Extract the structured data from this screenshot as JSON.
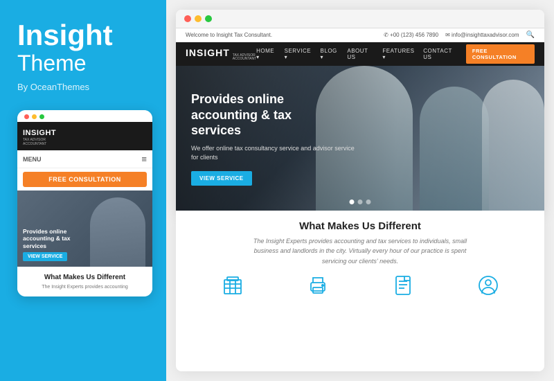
{
  "left": {
    "title_insight": "Insight",
    "title_theme": "Theme",
    "by_label": "By OceanThemes"
  },
  "mobile": {
    "dots": [
      "red",
      "yellow",
      "green"
    ],
    "logo": "INSIGHT",
    "logo_sub1": "TAX ADVISOR",
    "logo_sub2": "ACCOUNTANT",
    "menu_label": "MENU",
    "hamburger": "≡",
    "cta_btn": "FREE CONSULTATION",
    "hero_title": "Provides online accounting & tax services",
    "view_btn": "VIEW SERVICE",
    "section_title": "What Makes Us",
    "section_title2": "Different",
    "section_text": "The Insight Experts provides accounting"
  },
  "desktop": {
    "topbar_welcome": "Welcome to Insight Tax Consultant.",
    "topbar_phone": "✆ +00 (123) 456 7890",
    "topbar_email": "✉ info@insighttaxadvisor.com",
    "logo": "INSIGHT",
    "logo_sub1": "TAX ADVISOR",
    "logo_sub2": "ACCOUNTANT",
    "nav_links": [
      "HOME",
      "SERVICE",
      "BLOG",
      "ABOUT US",
      "FEATURES",
      "CONTACT US"
    ],
    "nav_cta": "FREE CONSULTATION",
    "hero_heading": "Provides online\naccounting & tax\nservices",
    "hero_subtext": "We offer online tax consultancy service and advisor service for clients",
    "hero_view_btn": "VIEW SERVICE",
    "dots": [
      "active",
      "",
      ""
    ],
    "bottom_title": "What Makes Us Different",
    "bottom_subtitle": "The Insight Experts provides accounting and tax services to individuals, small\nbusiness and landlords in the city. Virtually every hour of our practice is spent\nservicing our clients' needs.",
    "icons": [
      "building-icon",
      "printer-icon",
      "document-icon",
      "user-circle-icon"
    ]
  }
}
